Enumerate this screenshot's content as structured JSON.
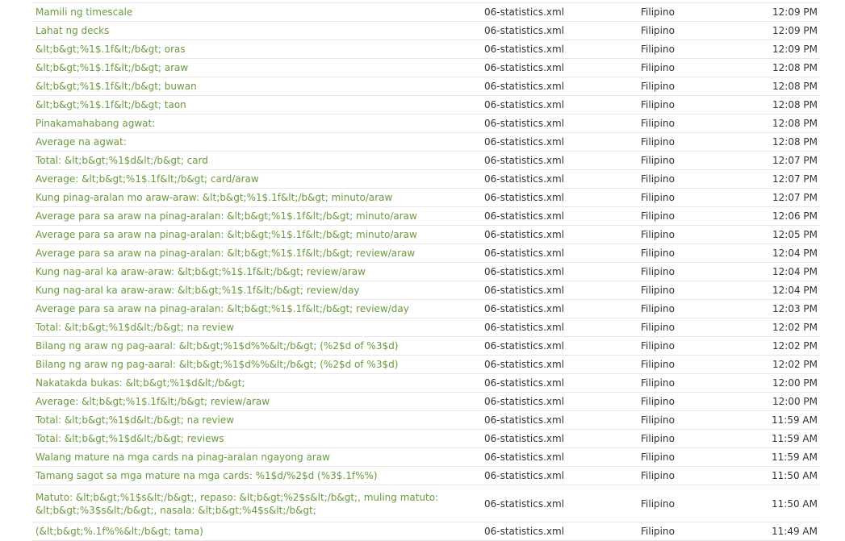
{
  "rows": [
    {
      "text": "Mamili ng timescale",
      "file": "06-statistics.xml",
      "language": "Filipino",
      "time": "12:09 PM"
    },
    {
      "text": "Lahat ng decks",
      "file": "06-statistics.xml",
      "language": "Filipino",
      "time": "12:09 PM"
    },
    {
      "text": "&lt;b&gt;%1$.1f&lt;/b&gt; oras",
      "file": "06-statistics.xml",
      "language": "Filipino",
      "time": "12:09 PM"
    },
    {
      "text": "&lt;b&gt;%1$.1f&lt;/b&gt; araw",
      "file": "06-statistics.xml",
      "language": "Filipino",
      "time": "12:08 PM"
    },
    {
      "text": "&lt;b&gt;%1$.1f&lt;/b&gt; buwan",
      "file": "06-statistics.xml",
      "language": "Filipino",
      "time": "12:08 PM"
    },
    {
      "text": "&lt;b&gt;%1$.1f&lt;/b&gt; taon",
      "file": "06-statistics.xml",
      "language": "Filipino",
      "time": "12:08 PM"
    },
    {
      "text": "Pinakamahabang agwat:",
      "file": "06-statistics.xml",
      "language": "Filipino",
      "time": "12:08 PM"
    },
    {
      "text": "Average na agwat:",
      "file": "06-statistics.xml",
      "language": "Filipino",
      "time": "12:08 PM"
    },
    {
      "text": "Total: &lt;b&gt;%1$d&lt;/b&gt; card",
      "file": "06-statistics.xml",
      "language": "Filipino",
      "time": "12:07 PM"
    },
    {
      "text": "Average: &lt;b&gt;%1$.1f&lt;/b&gt; card/araw",
      "file": "06-statistics.xml",
      "language": "Filipino",
      "time": "12:07 PM"
    },
    {
      "text": "Kung pinag-aralan mo araw-araw: &lt;b&gt;%1$.1f&lt;/b&gt; minuto/araw",
      "file": "06-statistics.xml",
      "language": "Filipino",
      "time": "12:07 PM"
    },
    {
      "text": "Average para sa araw na pinag-aralan: &lt;b&gt;%1$.1f&lt;/b&gt; minuto/araw",
      "file": "06-statistics.xml",
      "language": "Filipino",
      "time": "12:06 PM"
    },
    {
      "text": "Average para sa araw na pinag-aralan: &lt;b&gt;%1$.1f&lt;/b&gt; minuto/araw",
      "file": "06-statistics.xml",
      "language": "Filipino",
      "time": "12:05 PM"
    },
    {
      "text": "Average para sa araw na pinag-aralan: &lt;b&gt;%1$.1f&lt;/b&gt; review/araw",
      "file": "06-statistics.xml",
      "language": "Filipino",
      "time": "12:04 PM"
    },
    {
      "text": "Kung nag-aral ka araw-araw: &lt;b&gt;%1$.1f&lt;/b&gt; review/araw",
      "file": "06-statistics.xml",
      "language": "Filipino",
      "time": "12:04 PM"
    },
    {
      "text": "Kung nag-aral ka araw-araw: &lt;b&gt;%1$.1f&lt;/b&gt; review/day",
      "file": "06-statistics.xml",
      "language": "Filipino",
      "time": "12:04 PM"
    },
    {
      "text": "Average para sa araw na pinag-aralan: &lt;b&gt;%1$.1f&lt;/b&gt; review/day",
      "file": "06-statistics.xml",
      "language": "Filipino",
      "time": "12:03 PM"
    },
    {
      "text": "Total: &lt;b&gt;%1$d&lt;/b&gt; na review",
      "file": "06-statistics.xml",
      "language": "Filipino",
      "time": "12:02 PM"
    },
    {
      "text": "Bilang ng araw ng pag-aaral: &lt;b&gt;%1$d%%&lt;/b&gt; (%2$d of %3$d)",
      "file": "06-statistics.xml",
      "language": "Filipino",
      "time": "12:02 PM"
    },
    {
      "text": "Bilang ng araw ng pag-aaral: &lt;b&gt;%1$d%%&lt;/b&gt; (%2$d of %3$d)",
      "file": "06-statistics.xml",
      "language": "Filipino",
      "time": "12:02 PM"
    },
    {
      "text": "Nakatakda bukas: &lt;b&gt;%1$d&lt;/b&gt;",
      "file": "06-statistics.xml",
      "language": "Filipino",
      "time": "12:00 PM"
    },
    {
      "text": "Average: &lt;b&gt;%1$.1f&lt;/b&gt; review/araw",
      "file": "06-statistics.xml",
      "language": "Filipino",
      "time": "12:00 PM"
    },
    {
      "text": "Total: &lt;b&gt;%1$d&lt;/b&gt; na review",
      "file": "06-statistics.xml",
      "language": "Filipino",
      "time": "11:59 AM"
    },
    {
      "text": "Total: &lt;b&gt;%1$d&lt;/b&gt; reviews",
      "file": "06-statistics.xml",
      "language": "Filipino",
      "time": "11:59 AM"
    },
    {
      "text": "Walang mature na mga cards na pinag-aralan ngayong araw",
      "file": "06-statistics.xml",
      "language": "Filipino",
      "time": "11:59 AM"
    },
    {
      "text": "Tamang sagot sa mga mature na mga cards: %1$d/%2$d (%3$.1f%%)",
      "file": "06-statistics.xml",
      "language": "Filipino",
      "time": "11:50 AM"
    },
    {
      "text": "Matuto: &lt;b&gt;%1$s&lt;/b&gt;, repaso: &lt;b&gt;%2$s&lt;/b&gt;, muling matuto: &lt;b&gt;%3$s&lt;/b&gt;, nasala: &lt;b&gt;%4$s&lt;/b&gt;",
      "file": "06-statistics.xml",
      "language": "Filipino",
      "time": "11:50 AM",
      "tall": true
    },
    {
      "text": "(&lt;b&gt;%.1f%%&lt;/b&gt; tama)",
      "file": "06-statistics.xml",
      "language": "Filipino",
      "time": "11:49 AM"
    }
  ]
}
